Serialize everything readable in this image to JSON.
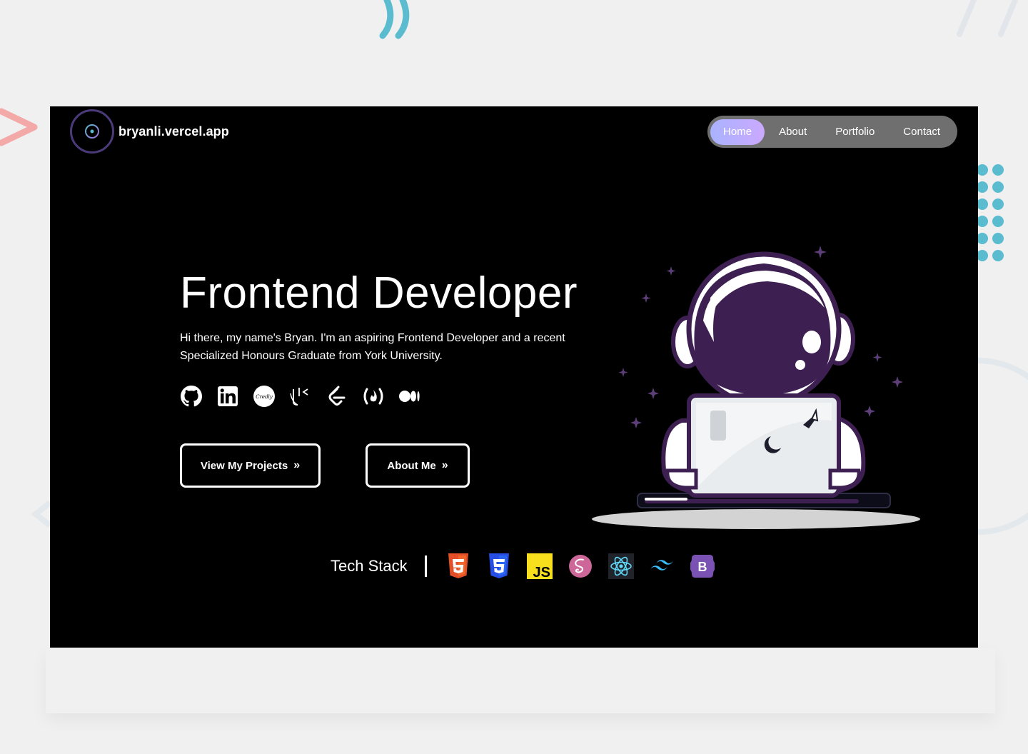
{
  "header": {
    "site_name": "bryanli.vercel.app",
    "nav": [
      {
        "label": "Home",
        "active": true
      },
      {
        "label": "About",
        "active": false
      },
      {
        "label": "Portfolio",
        "active": false
      },
      {
        "label": "Contact",
        "active": false
      }
    ]
  },
  "hero": {
    "title": "Frontend Developer",
    "description": "Hi there, my name's Bryan. I'm an aspiring Frontend Developer and a recent Specialized Honours Graduate from York University.",
    "socials": [
      "github-icon",
      "linkedin-icon",
      "credly-icon",
      "kattis-icon",
      "leetcode-icon",
      "freecodecamp-icon",
      "medium-icon"
    ],
    "credly_mark": "Credly",
    "primary_button": "View My Projects",
    "secondary_button": "About Me",
    "chevron": "»"
  },
  "tech_stack": {
    "label": "Tech Stack",
    "icons": [
      "html5-icon",
      "css3-icon",
      "javascript-icon",
      "sass-icon",
      "react-icon",
      "tailwind-icon",
      "bootstrap-icon"
    ],
    "js_text": "JS",
    "bootstrap_text": "B"
  },
  "colors": {
    "page_bg": "#f0f0f0",
    "site_bg": "#000000",
    "nav_bg": "#6f6f6f",
    "nav_active_start": "#a9b3ff",
    "nav_active_end": "#cba9ff",
    "astronaut_helmet": "#3d1f52",
    "deco_cyan": "#5bbccf",
    "deco_pink": "#f4a9a9"
  }
}
